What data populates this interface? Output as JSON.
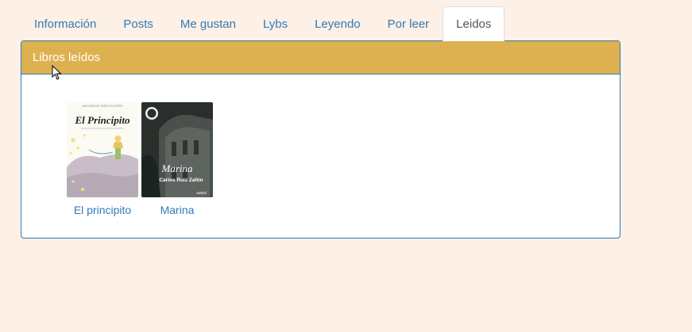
{
  "tabs": [
    {
      "label": "Información"
    },
    {
      "label": "Posts"
    },
    {
      "label": "Me gustan"
    },
    {
      "label": "Lybs"
    },
    {
      "label": "Leyendo"
    },
    {
      "label": "Por leer"
    },
    {
      "label": "Leidos"
    }
  ],
  "panel": {
    "heading": "Libros leídos",
    "books": [
      {
        "title": "El principito",
        "cover_text": "El Principito",
        "cover_author": "ANTOINE DE SAINT-EXUPÉRY"
      },
      {
        "title": "Marina",
        "cover_text": "Marina",
        "cover_author": "Carlos Ruiz Zafón",
        "publisher": "edebé"
      }
    ]
  },
  "colors": {
    "accent": "#337ab7",
    "heading_bg": "#ddb14f",
    "page_bg": "#fdf0e6"
  }
}
